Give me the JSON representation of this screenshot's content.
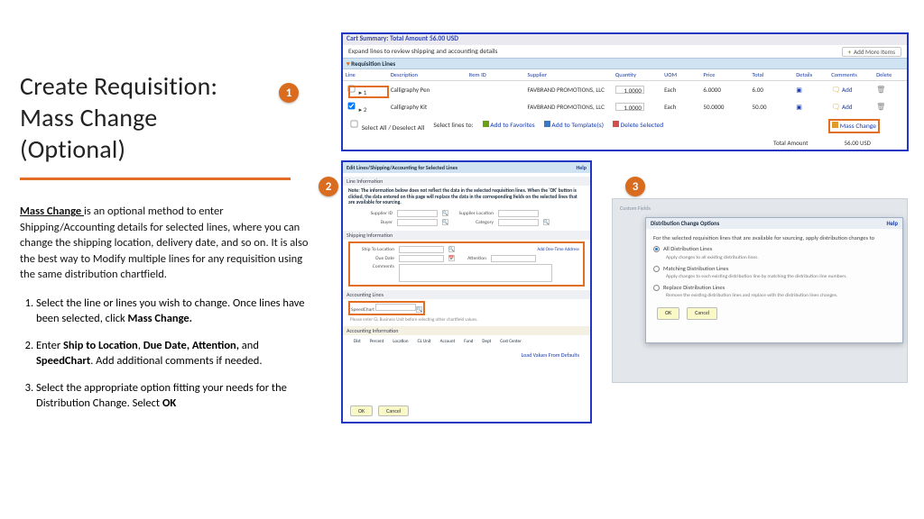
{
  "left": {
    "title_l1": "Create Requisition:",
    "title_l2": "Mass Change",
    "title_l3": "(Optional)",
    "desc_bold": "Mass Change ",
    "desc_rest": "is an optional method to enter Shipping/Accounting details for selected lines, where you can change the shipping location, delivery date, and so on. It is also the best way to Modify multiple lines for any requisition using the same distribution chartfield.",
    "steps": [
      {
        "pre": "Select the line or lines you wish to change. Once lines have been selected, click ",
        "b": "Mass Change.",
        "post": ""
      },
      {
        "pre": "Enter ",
        "b": "Ship to Location",
        "mid": ", ",
        "b2": "Due Date, Attention,",
        "mid2": " and ",
        "b3": "SpeedChart",
        "post": ". Add additional comments if needed."
      },
      {
        "pre": "Select the appropriate option fitting your needs for the Distribution Change. Select ",
        "b": "OK",
        "post": ""
      }
    ]
  },
  "circles": {
    "c1": "1",
    "c2": "2",
    "c3": "3"
  },
  "p1": {
    "summary": "Cart Summary: Total Amount 56.00 USD",
    "expand": "Expand lines to review shipping and accounting details",
    "addmore": "Add More Items",
    "reqhdr": "Requisition Lines",
    "headers": [
      "Line",
      "Description",
      "Item ID",
      "Supplier",
      "Quantity",
      "UOM",
      "Price",
      "Total",
      "Details",
      "Comments",
      "Delete"
    ],
    "rows": [
      {
        "line": "1",
        "desc": "Calligraphy Pen",
        "supplier": "FAVBRAND PROMOTIONS, LLC",
        "qty": "1.0000",
        "uom": "Each",
        "price": "6.0000",
        "total": "6.00"
      },
      {
        "line": "2",
        "desc": "Calligraphy Kit",
        "supplier": "FAVBRAND PROMOTIONS, LLC",
        "qty": "1.0000",
        "uom": "Each",
        "price": "50.0000",
        "total": "50.00"
      }
    ],
    "selectall": "Select All / Deselect All",
    "selectlines": "Select lines to:",
    "fav": "Add to Favorites",
    "tmpl": "Add to Template(s)",
    "delsel": "Delete Selected",
    "mass": "Mass Change",
    "totallbl": "Total Amount",
    "totalval": "56.00 USD",
    "add": "Add"
  },
  "p2": {
    "header": "Edit Lines/Shipping/Accounting for Selected Lines",
    "help": "Help",
    "section_line": "Line Information",
    "note": "Note: The information below does not reflect the data in the selected requisition lines. When the 'OK' button is clicked, the data entered on this page will replace the data in the corresponding fields on the selected lines that are available for sourcing.",
    "supplier_id": "Supplier ID",
    "supplier_loc": "Supplier Location",
    "buyer": "Buyer",
    "category": "Category",
    "section_ship": "Shipping Information",
    "ship_to": "Ship To Location",
    "due": "Due Date",
    "attn": "Attention",
    "onetime": "Add One-Time Address",
    "comments": "Comments",
    "section_acct": "Accounting Lines",
    "speedchart": "SpeedChart",
    "speednote": "Please enter GL Business Unit before selecting other chartfield values.",
    "acctinfo": "Accounting Information",
    "acctcols": [
      "Dist",
      "Percent",
      "Location",
      "GL Unit",
      "Account",
      "Fund",
      "Dept",
      "Cost Center"
    ],
    "loadvals": "Load Values From Defaults",
    "ok": "OK",
    "cancel": "Cancel"
  },
  "p3": {
    "ghost1": "Custom Fields",
    "title": "Distribution Change Options",
    "help": "Help",
    "lead": "For the selected requisition lines that are available for sourcing, apply distribution changes to",
    "opt1": "All Distribution Lines",
    "opt1sub": "Apply changes to all existing distribution lines.",
    "opt2": "Matching Distribution Lines",
    "opt2sub": "Apply changes to each existing distribution line by matching the distribution line numbers.",
    "opt3": "Replace Distribution Lines",
    "opt3sub": "Remove the existing distribution lines and replace with the distribution lines changes.",
    "ok": "OK",
    "cancel": "Cancel"
  }
}
